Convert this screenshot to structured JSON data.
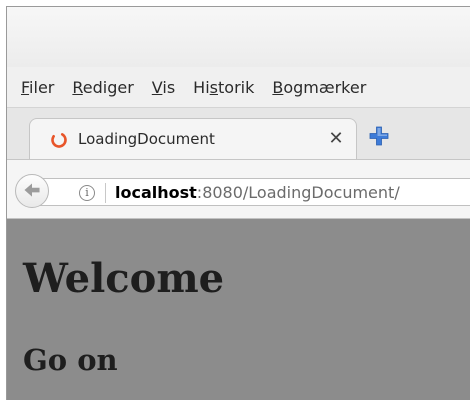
{
  "menubar": {
    "items": [
      {
        "accel": "F",
        "rest": "iler"
      },
      {
        "accel": "R",
        "rest": "ediger"
      },
      {
        "accel": "V",
        "rest": "is"
      },
      {
        "pre": "Hi",
        "accel": "s",
        "rest": "torik"
      },
      {
        "accel": "B",
        "rest": "ogmærker"
      }
    ]
  },
  "tabs": [
    {
      "title": "LoadingDocument",
      "close_glyph": "✕",
      "status": "loading"
    }
  ],
  "newtab": {
    "icon": "plus-icon"
  },
  "navbar": {
    "back_icon": "back-arrow-icon",
    "info_icon": "info-icon",
    "info_glyph": "i",
    "url_host": "localhost",
    "url_rest": ":8080/LoadingDocument/"
  },
  "page": {
    "heading": "Welcome",
    "subheading": "Go on"
  },
  "colors": {
    "content_bg": "#8c8c8c",
    "throbber": "#e8552a",
    "plus": "#3d7bd8"
  }
}
